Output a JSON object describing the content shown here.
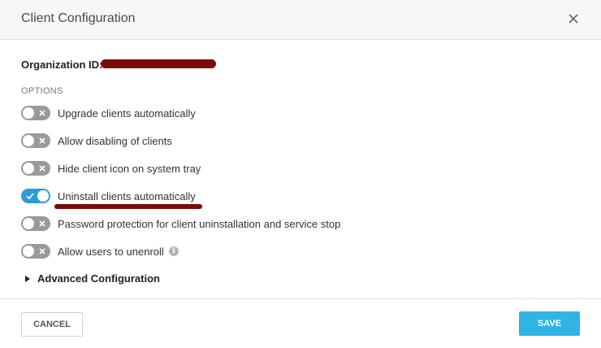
{
  "dialog": {
    "title": "Client Configuration",
    "close_icon": "close-icon"
  },
  "organization": {
    "label": "Organization ID:",
    "value_redacted": true
  },
  "options": {
    "heading": "OPTIONS",
    "items": [
      {
        "label": "Upgrade clients automatically",
        "enabled": false
      },
      {
        "label": "Allow disabling of clients",
        "enabled": false
      },
      {
        "label": "Hide client icon on system tray",
        "enabled": false
      },
      {
        "label": "Uninstall clients automatically",
        "enabled": true
      },
      {
        "label": "Password protection for client uninstallation and service stop",
        "enabled": false
      },
      {
        "label": "Allow users to unenroll",
        "enabled": false,
        "info_icon": "info-icon"
      }
    ]
  },
  "advanced": {
    "label": "Advanced Configuration",
    "expanded": false
  },
  "footer": {
    "cancel_label": "CANCEL",
    "save_label": "SAVE"
  },
  "colors": {
    "toggle_on": "#2d9cdb",
    "toggle_off": "#9a9a9a",
    "save_button": "#2eb5e6",
    "redaction": "#7a0b0b"
  }
}
